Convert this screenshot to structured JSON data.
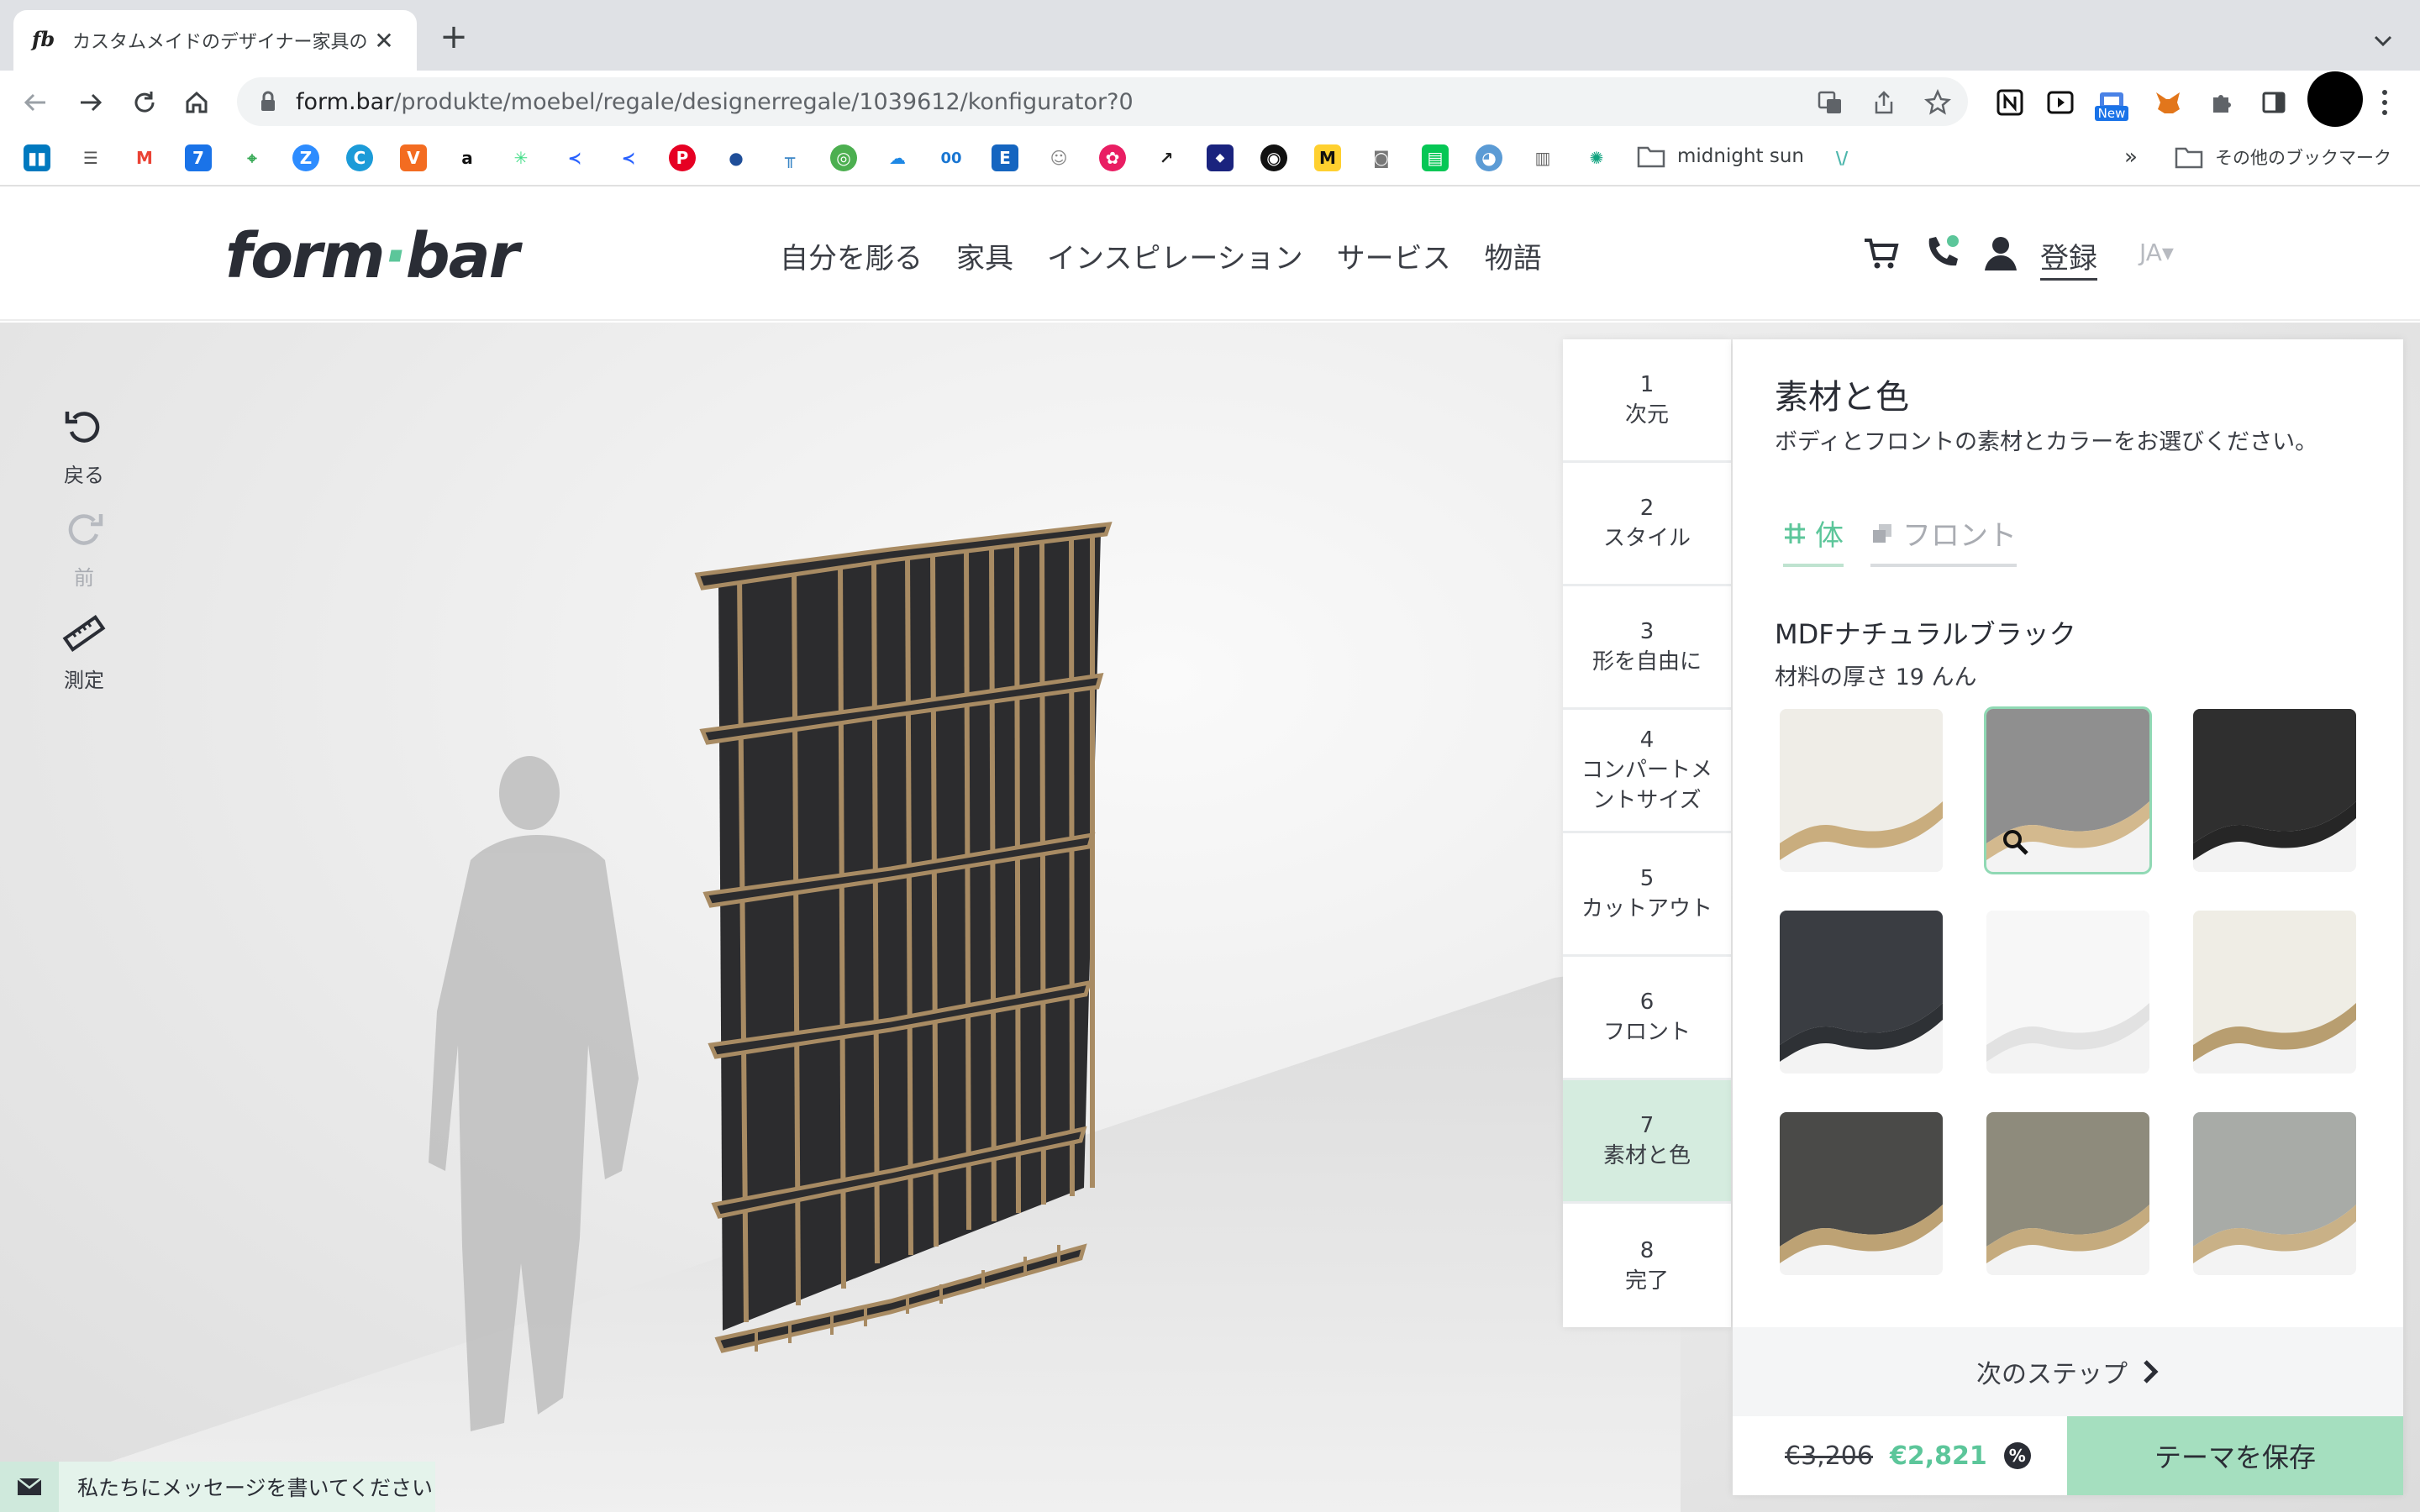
{
  "browser": {
    "tab_favicon": "fb",
    "tab_title": "カスタムメイドのデザイナー家具の",
    "tab_close": "✕",
    "new_tab": "+",
    "url_host": "form.bar",
    "url_path": "/produkte/moebel/regale/designerregale/1039612/konfigurator?0",
    "extension_new_badge": "New",
    "bookmarks_more": "»",
    "bookmark_folder_1": "midnight sun",
    "bookmark_folder_2": "その他のブックマーク"
  },
  "site": {
    "logo_a": "form",
    "logo_b": "bar",
    "nav": [
      "自分を彫る",
      "家具",
      "インスピレーション",
      "サービス",
      "物語"
    ],
    "login": "登録",
    "lang": "JA▾"
  },
  "tools": {
    "undo": "戻る",
    "redo": "前",
    "measure": "測定"
  },
  "steps": [
    {
      "num": "1",
      "label": "次元"
    },
    {
      "num": "2",
      "label": "スタイル"
    },
    {
      "num": "3",
      "label": "形を自由に"
    },
    {
      "num": "4",
      "label": "コンパートメ"
    },
    {
      "num": "5",
      "label": "カットアウト"
    },
    {
      "num": "6",
      "label": "フロント"
    },
    {
      "num": "7",
      "label": "素材と色"
    },
    {
      "num": "8",
      "label": "完了"
    }
  ],
  "step4_line2": "ントサイズ",
  "active_step": 7,
  "panel": {
    "title": "素材と色",
    "subtitle": "ボディとフロントの素材とカラーをお選びください。",
    "tab_body": "体",
    "tab_front": "フロント",
    "material_name": "MDFナチュラルブラック",
    "material_thickness": "材料の厚さ 19 んん",
    "swatches": [
      {
        "icon": "swatch-cream-birch",
        "top": "#efede7",
        "edge": "#c9ad7e",
        "selected": false
      },
      {
        "icon": "swatch-grey-birch",
        "top": "#8f8f8f",
        "edge": "#d3b98e",
        "selected": true
      },
      {
        "icon": "swatch-black-mdf",
        "top": "#2f2f2f",
        "edge": "#262626",
        "selected": false
      },
      {
        "icon": "swatch-anthracite",
        "top": "#3a3d42",
        "edge": "#2e3135",
        "selected": false
      },
      {
        "icon": "swatch-white",
        "top": "#f7f7f7",
        "edge": "#e2e2e2",
        "selected": false
      },
      {
        "icon": "swatch-white-plywood",
        "top": "#efede5",
        "edge": "#b89e70",
        "selected": false
      },
      {
        "icon": "swatch-black-plywood",
        "top": "#4a4a48",
        "edge": "#bda274",
        "selected": false
      },
      {
        "icon": "swatch-olive-plywood",
        "top": "#8e8b7c",
        "edge": "#c5ab7e",
        "selected": false
      },
      {
        "icon": "swatch-sage-plywood",
        "top": "#a8aba7",
        "edge": "#c9b187",
        "selected": false
      }
    ],
    "next_step": "次のステップ",
    "price_old": "€3,206",
    "price_new": "€2,821",
    "discount_icon": "%",
    "save_button": "テーマを保存"
  },
  "chat": {
    "label": "私たちにメッセージを書いてください"
  },
  "colors": {
    "accent": "#5cc69a",
    "active_step_bg": "#d5ecdf",
    "save_bg": "#a5dfbf",
    "shelf_body": "#2b2b2d",
    "shelf_edge": "#a88b63"
  }
}
